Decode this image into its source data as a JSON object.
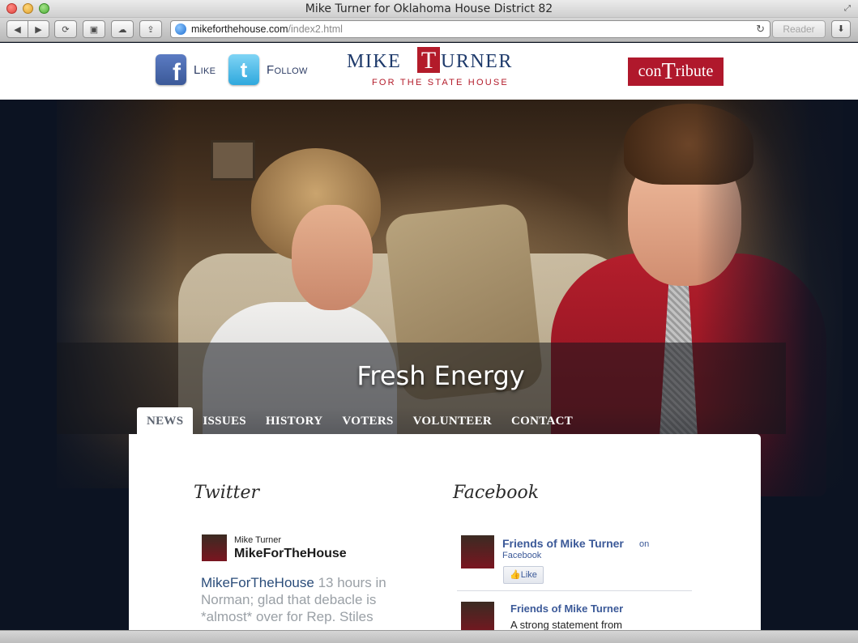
{
  "window": {
    "title": "Mike Turner for Oklahoma House District 82"
  },
  "toolbar": {
    "url_host": "mikeforthehouse.com",
    "url_path": "/index2.html",
    "reader_label": "Reader"
  },
  "header": {
    "like_label": "Like",
    "follow_label": "Follow",
    "logo_mike": "MIKE",
    "logo_t": "T",
    "logo_turner": "URNER",
    "logo_tagline": "FOR THE STATE HOUSE",
    "contribute_pre": "con",
    "contribute_t": "T",
    "contribute_post": "ribute"
  },
  "hero": {
    "title": "Fresh Energy"
  },
  "nav": {
    "items": [
      "NEWS",
      "ISSUES",
      "HISTORY",
      "VOTERS",
      "VOLUNTEER",
      "CONTACT"
    ],
    "active": "NEWS"
  },
  "twitter": {
    "heading": "Twitter",
    "display_name": "Mike Turner",
    "handle": "MikeForTheHouse",
    "tweet_user": "MikeForTheHouse",
    "tweet_time": "13 hours in",
    "tweet_line2": "Norman; glad that debacle is",
    "tweet_line3": "*almost* over for Rep. Stiles"
  },
  "facebook": {
    "heading": "Facebook",
    "page_name": "Friends of Mike Turner",
    "on_text": "on",
    "platform": "Facebook",
    "like_label": "Like",
    "post_author": "Friends of Mike Turner",
    "post_text": "A strong statement from"
  },
  "colors": {
    "brand_red": "#b0182c",
    "brand_navy": "#1e3a6b",
    "facebook_blue": "#3b5998",
    "twitter_blue": "#2fa8dd"
  }
}
